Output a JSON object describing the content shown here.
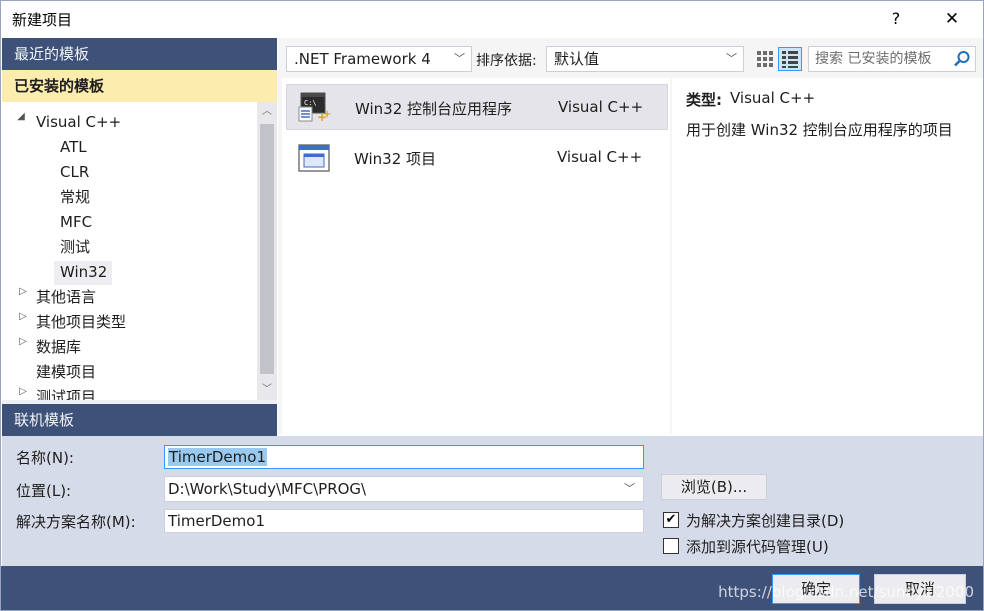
{
  "window": {
    "title": "新建项目",
    "help_label": "?",
    "close_label": "✕"
  },
  "left_nav": {
    "recent_label": "最近的模板",
    "installed_label": "已安装的模板",
    "online_label": "联机模板",
    "tree": [
      {
        "label": "Visual C++",
        "expanded": true
      },
      {
        "label": "ATL"
      },
      {
        "label": "CLR"
      },
      {
        "label": "常规"
      },
      {
        "label": "MFC"
      },
      {
        "label": "测试"
      },
      {
        "label": "Win32",
        "selected": true
      },
      {
        "label": "其他语言",
        "expanded": false
      },
      {
        "label": "其他项目类型",
        "expanded": false
      },
      {
        "label": "数据库",
        "expanded": false
      },
      {
        "label": "建模项目"
      },
      {
        "label": "测试项目",
        "expanded": false
      }
    ]
  },
  "toolbar": {
    "framework_value": ".NET Framework 4",
    "sort_label": "排序依据:",
    "sort_value": "默认值",
    "search_placeholder": "搜索 已安装的模板"
  },
  "templates": [
    {
      "name": "Win32 控制台应用程序",
      "language": "Visual C++",
      "selected": true,
      "icon": "console-app-icon"
    },
    {
      "name": "Win32 项目",
      "language": "Visual C++",
      "selected": false,
      "icon": "window-app-icon"
    }
  ],
  "description": {
    "type_label": "类型:",
    "type_value": "Visual C++",
    "text": "用于创建 Win32 控制台应用程序的项目"
  },
  "form": {
    "name_label": "名称(N):",
    "name_value": "TimerDemo1",
    "location_label": "位置(L):",
    "location_value": "D:\\Work\\Study\\MFC\\PROG\\",
    "browse_label": "浏览(B)...",
    "solution_label": "解决方案名称(M):",
    "solution_value": "TimerDemo1",
    "create_dir_label": "为解决方案创建目录(D)",
    "create_dir_checked": true,
    "source_control_label": "添加到源代码管理(U)",
    "source_control_checked": false
  },
  "footer": {
    "ok_label": "确定",
    "cancel_label": "取消",
    "watermark": "https://blog.csdn.net/sunnyzl2000"
  },
  "colors": {
    "nav_header": "#3e5279",
    "installed_highlight": "#fcecad",
    "form_background": "#d6dbe9",
    "focus_border": "#3399ff"
  }
}
